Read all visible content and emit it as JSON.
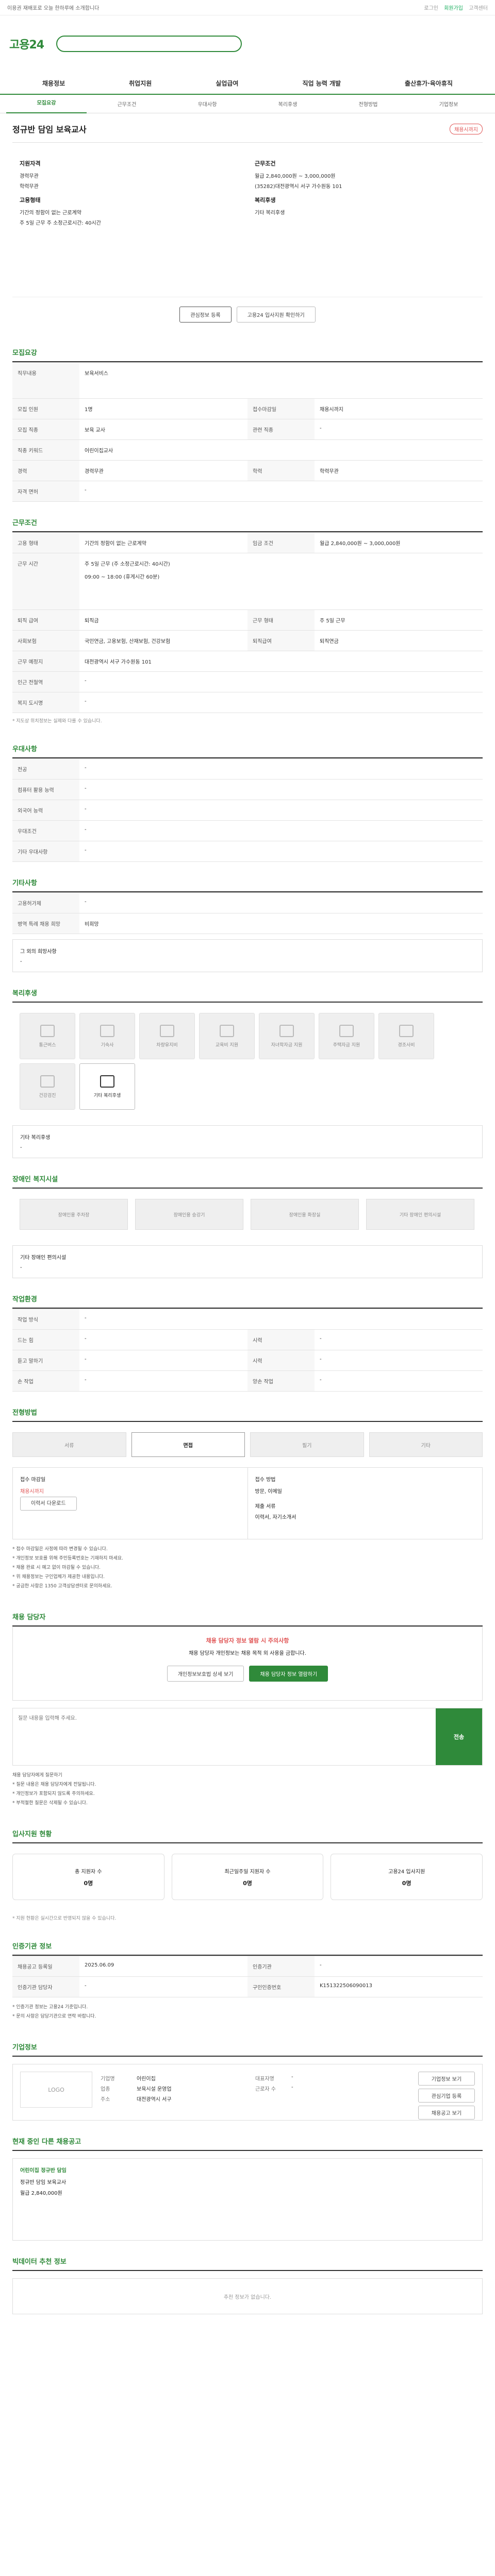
{
  "topbar": {
    "left": "이용권 재배포로 오늘 한하루에 소개합니다",
    "links": [
      "로그인",
      "회원가입",
      "고객센터"
    ]
  },
  "logo": "고용24",
  "nav": [
    "채용정보",
    "취업지원",
    "실업급여",
    "직업 능력 개발",
    "출산휴가·육아휴직"
  ],
  "subtabs": [
    "모집요강",
    "근무조건",
    "우대사항",
    "복리후생",
    "전형방법",
    "기업정보"
  ],
  "title": "정규반 담임 보육교사",
  "badge": "채용시까지",
  "info": {
    "left_h": "지원자격",
    "exp": "경력무관",
    "edu": "학력무관",
    "left_h2": "고용형태",
    "type": "기간의 정함이 없는 근로계약",
    "hours": "주 5일 근무 주 소정근로시간: 40시간",
    "right_h": "근무조건",
    "pay": "월급 2,840,000원 ~ 3,000,000원",
    "loc": "(35282)대전광역시 서구 가수원동 101",
    "right_h2": "복리후생",
    "welfare": "기타 복리후생"
  },
  "buttons": {
    "scrap": "관심정보 등록",
    "compare": "고용24 입사지원 확인하기"
  },
  "sec_recruit": {
    "h": "모집요강",
    "job_k": "직무내용",
    "job_v": "보육서비스",
    "rows": [
      [
        "모집 인원",
        "1명",
        "접수마감일",
        "채용시까지"
      ],
      [
        "모집 직종",
        "보육 교사",
        "관련 직종",
        "-"
      ],
      [
        "직종 키워드",
        "어린이집교사",
        ""
      ],
      [
        "경력",
        "경력무관",
        "학력",
        "학력무관"
      ],
      [
        "자격 면허",
        "-"
      ]
    ]
  },
  "sec_cond": {
    "h": "근무조건",
    "rows": [
      [
        "고용 형태",
        "기간의 정함이 없는 근로계약",
        "임금 조건",
        "월급 2,840,000원 ~ 3,000,000원"
      ],
      [
        "근무 시간",
        "주 5일 근무 (주 소정근로시간: 40시간)",
        ""
      ],
      [
        "근무 시간 세부",
        "09:00 ~ 18:00 (휴게시간 60분)",
        ""
      ],
      [
        "퇴직 급여",
        "퇴직금",
        "근무 형태",
        "주 5일 근무"
      ],
      [
        "사회보험",
        "국민연금, 고용보험, 산재보험, 건강보험",
        "퇴직급여",
        "퇴직연금"
      ],
      [
        "근무 예정지",
        "대전광역시 서구 가수원동 101",
        "",
        ""
      ],
      [
        "인근 전철역",
        "-",
        ""
      ],
      [
        "복지 도시명",
        "-",
        ""
      ]
    ],
    "note": "* 지도상 위치정보는 실제와 다를 수 있습니다."
  },
  "sec_pref": {
    "h": "우대사항",
    "rows": [
      [
        "전공",
        "-"
      ],
      [
        "컴퓨터 활용 능력",
        "-"
      ],
      [
        "외국어 능력",
        "-"
      ],
      [
        "우대조건",
        "-"
      ],
      [
        "기타 우대사항",
        "-"
      ]
    ]
  },
  "sec_etc": {
    "h": "기타사항",
    "rows": [
      [
        "고용허가제",
        "-"
      ],
      [
        "병역 특례 채용 희망",
        "비희망"
      ]
    ],
    "extra": "그 외의 희망사항",
    "extra_v": "-"
  },
  "sec_welfare": {
    "h": "복리후생",
    "cards": [
      "통근버스",
      "기숙사",
      "차량유지비",
      "교육비 지원",
      "자녀학자금 지원",
      "주택자금 지원",
      "경조사비",
      "건강검진",
      "기타 복리후생"
    ],
    "detail_k": "기타 복리후생",
    "detail_v": "-"
  },
  "sec_disab": {
    "h": "장애인 복지시설",
    "cards": [
      "장애인용 주차장",
      "장애인용 승강기",
      "장애인용 화장실",
      "기타 장애인 편의시설"
    ],
    "detail": "기타 장애인 편의시설",
    "detail_v": "-"
  },
  "sec_work": {
    "h": "작업환경",
    "rows": [
      [
        "작업 방식",
        "-"
      ],
      [
        "드는 힘",
        "-",
        "시력",
        "-"
      ],
      [
        "듣고 말하기",
        "-",
        "시력",
        "-"
      ],
      [
        "손 작업",
        "-",
        "양손 작업",
        "-"
      ]
    ]
  },
  "sec_proc": {
    "h": "전형방법",
    "steps": [
      "서류",
      "면접",
      "필기",
      "기타"
    ],
    "deadline_k": "접수 마감일",
    "deadline_v": "채용시까지",
    "method_k": "접수 방법",
    "method_v": "방문, 이메일",
    "doc_k": "제출 서류",
    "doc_v": "이력서, 자기소개서",
    "btn": "이력서 다운로드",
    "bullets": [
      "* 접수 마감일은 사정에 따라 변경될 수 있습니다.",
      "* 개인정보 보호를 위해 주민등록번호는 기재하지 마세요.",
      "* 채용 완료 시 예고 없이 마감될 수 있습니다.",
      "* 위 채용정보는 구인업체가 제공한 내용입니다.",
      "* 궁금한 사항은 1350 고객상담센터로 문의하세요."
    ]
  },
  "sec_inquiry": {
    "h": "채용 담당자",
    "warn_t": "채용 담당자 정보 열람 시 주의사항",
    "warn_1": "채용 담당자 개인정보는 채용 목적 외 사용을 금합니다.",
    "btn1": "개인정보보호법 상세 보기",
    "btn2": "채용 담당자 정보 열람하기",
    "q_k": "채용 담당자에게 질문하기",
    "placeholder": "질문 내용을 입력해 주세요.",
    "send": "전송",
    "bullets": [
      "* 질문 내용은 채용 담당자에게 전달됩니다.",
      "* 개인정보가 포함되지 않도록 주의하세요.",
      "* 부적절한 질문은 삭제될 수 있습니다."
    ]
  },
  "sec_status": {
    "h": "입사지원 현황",
    "items": [
      [
        "총 지원자 수",
        "0명"
      ],
      [
        "최근일주일 지원자 수",
        "0명"
      ],
      [
        "고용24 입사지원",
        "0명"
      ]
    ],
    "note": "* 지원 현황은 실시간으로 반영되지 않을 수 있습니다."
  },
  "sec_org": {
    "h": "인증기관 정보",
    "rows": [
      [
        "채용공고 등록일",
        "2025.06.09",
        "인증기관",
        "-"
      ],
      [
        "인증기관 담당자",
        "-",
        "구인인증번호",
        "K151322506090013"
      ]
    ],
    "notes": [
      "* 인증기관 정보는 고용24 기준입니다.",
      "* 문의 사항은 담당기관으로 연락 바랍니다."
    ]
  },
  "sec_company": {
    "h": "기업정보",
    "logo": "LOGO",
    "rows": [
      [
        "기업명",
        "어린이집",
        "대표자명",
        "-"
      ],
      [
        "업종",
        "보육시설 운영업",
        "근로자 수",
        "-"
      ],
      [
        "주소",
        "대전광역시 서구",
        "",
        ""
      ]
    ],
    "btns": [
      "기업정보 보기",
      "관심기업 등록",
      "채용공고 보기"
    ]
  },
  "sec_other": {
    "h": "현재 중인 다른 채용공고",
    "name": "어린이집 정규반 담임",
    "info1": "정규반 담임 보육교사",
    "info2": "월급 2,840,000원"
  },
  "sec_reco": {
    "h": "빅데이터 추천 정보",
    "empty": "추천 정보가 없습니다."
  }
}
